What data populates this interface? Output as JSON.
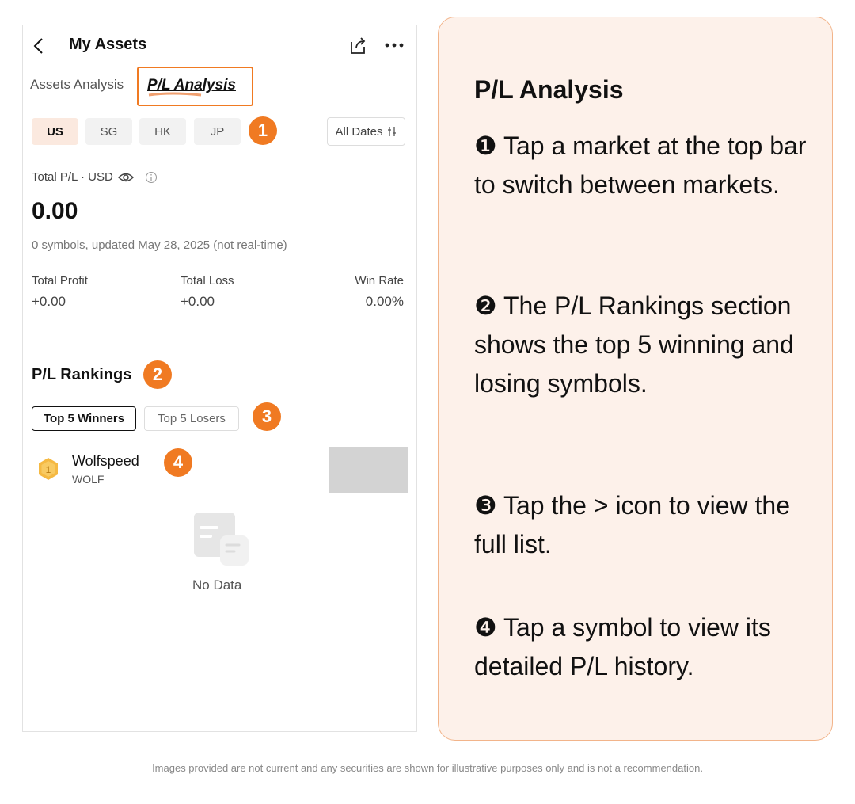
{
  "header": {
    "title": "My Assets"
  },
  "tabs": {
    "assets": "Assets Analysis",
    "pl": "P/L Analysis"
  },
  "markets": [
    "US",
    "SG",
    "HK",
    "JP"
  ],
  "filter": {
    "label": "All Dates"
  },
  "summary": {
    "label": "Total P/L · USD",
    "value": "0.00",
    "updated": "0 symbols, updated May 28, 2025 (not real-time)"
  },
  "stats": {
    "profit_label": "Total Profit",
    "profit_value": "+0.00",
    "loss_label": "Total Loss",
    "loss_value": "+0.00",
    "win_label": "Win Rate",
    "win_value": "0.00%"
  },
  "rankings": {
    "title": "P/L Rankings",
    "winners": "Top 5 Winners",
    "losers": "Top 5 Losers",
    "item": {
      "rank": "1",
      "name": "Wolfspeed",
      "code": "WOLF"
    },
    "empty": "No Data"
  },
  "badges": [
    "1",
    "2",
    "3",
    "4"
  ],
  "info": {
    "title": "P/L Analysis",
    "tip1": "❶ Tap a market at the top bar to switch between markets.",
    "tip2": "❷ The P/L Rankings section shows the top 5 winning and losing symbols.",
    "tip3": "❸ Tap the > icon to view the full list.",
    "tip4": "❹ Tap a symbol to view its detailed P/L history."
  },
  "disclaimer": "Images provided are not current and any securities are shown for illustrative purposes only and is not a recommendation.",
  "colors": {
    "accent": "#f07a22",
    "panel_bg": "#fdf1ea",
    "panel_border": "#f2b48a",
    "active_chip": "#fbe9df"
  }
}
